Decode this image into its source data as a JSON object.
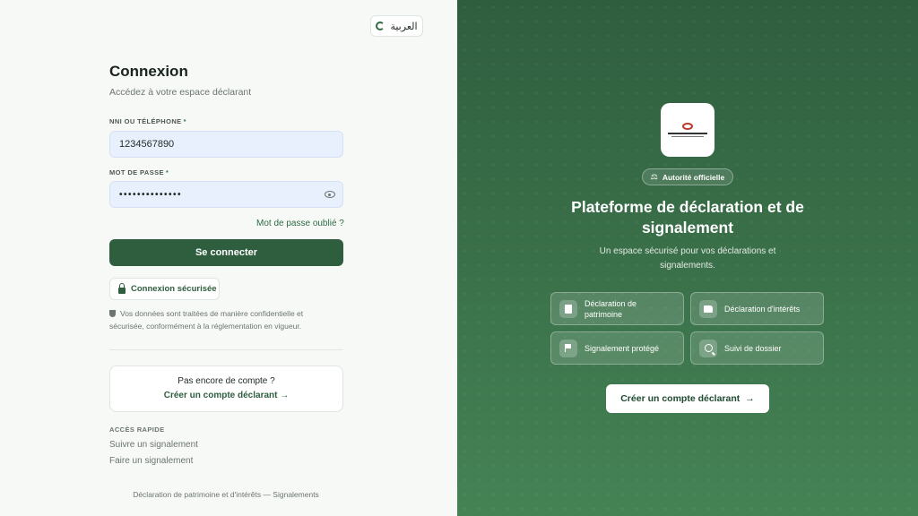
{
  "language_toggle": {
    "label": "العربية"
  },
  "login": {
    "title": "Connexion",
    "subtitle": "Accédez à votre espace déclarant",
    "id_label": "NNI OU TÉLÉPHONE",
    "id_value": "1234567890",
    "password_label": "MOT DE PASSE",
    "password_value": "••••••••••••••",
    "required_mark": "*",
    "forgot_label": "Mot de passe oublié ?",
    "submit_label": "Se connecter",
    "secure_label": "Connexion sécurisée",
    "privacy_text": "Vos données sont traitées de manière confidentielle et sécurisée, conformément à la réglementation en vigueur."
  },
  "signup": {
    "question": "Pas encore de compte ?",
    "link_label": "Créer un compte déclarant",
    "arrow": "→"
  },
  "quick_access": {
    "title": "ACCÈS RAPIDE",
    "links": [
      "Suivre un signalement",
      "Faire un signalement"
    ]
  },
  "footer": {
    "text": "Déclaration de patrimoine et d'intérêts — Signalements"
  },
  "hero": {
    "badge": "Autorité officielle",
    "badge_icon": "⚖",
    "title": "Plateforme de déclaration et de signalement",
    "subtitle": "Un espace sécurisé pour vos déclarations et signalements.",
    "features": [
      {
        "label": "Déclaration de patrimoine",
        "icon": "document-icon"
      },
      {
        "label": "Déclaration d'intérêts",
        "icon": "folder-icon"
      },
      {
        "label": "Signalement protégé",
        "icon": "flag-icon"
      },
      {
        "label": "Suivi de dossier",
        "icon": "search-icon"
      }
    ],
    "cta_label": "Créer un compte déclarant",
    "cta_arrow": "→"
  },
  "colors": {
    "primary": "#2f5e3f",
    "input_bg": "#e8effd",
    "panel_gradient_end": "#458355"
  }
}
